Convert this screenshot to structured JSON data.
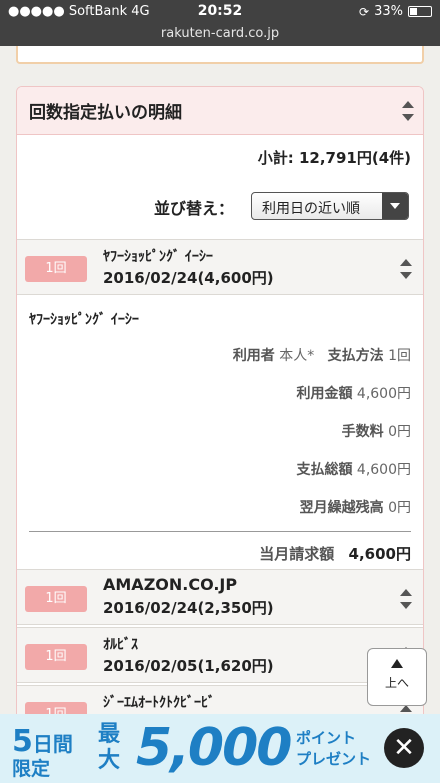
{
  "status_bar": {
    "carrier": "●●●●● SoftBank   4G",
    "time": "20:52",
    "battery": "33%",
    "battery_level": 0.33
  },
  "browser": {
    "url": "rakuten-card.co.jp"
  },
  "section": {
    "title": "回数指定払いの明細",
    "subtotal": "小計: 12,791円(4件)",
    "sort_label": "並び替え：",
    "sort_value": "利用日の近い順"
  },
  "items": [
    {
      "badge": "1回",
      "merchant": "ﾔﾌｰｼｮｯﾋﾟﾝｸﾞ ｲｰｼｰ",
      "date_amount": "2016/02/24(4,600円)"
    },
    {
      "badge": "1回",
      "merchant": "AMAZON.CO.JP",
      "date_amount": "2016/02/24(2,350円)"
    },
    {
      "badge": "1回",
      "merchant": "ｵﾙﾋﾞｽ",
      "date_amount": "2016/02/05(1,620円)"
    },
    {
      "badge": "1回",
      "merchant": "ｼﾞｰｴﾑｵｰﾄｸﾄｸﾋﾞｰﾋﾞ",
      "date_amount": ""
    }
  ],
  "detail": {
    "merchant": "ﾔﾌｰｼｮｯﾋﾟﾝｸﾞ ｲｰｼｰ",
    "user_label": "利用者",
    "user_value": "本人*",
    "method_label": "支払方法",
    "method_value": "1回",
    "amount_label": "利用金額",
    "amount_value": "4,600円",
    "fee_label": "手数料",
    "fee_value": "0円",
    "total_label": "支払総額",
    "total_value": "4,600円",
    "carry_label": "翌月繰越残高",
    "carry_value": "0円",
    "monthly_label": "当月請求額",
    "monthly_value": "4,600円"
  },
  "to_top": {
    "label": "上へ"
  },
  "banner": {
    "days_num": "5",
    "days_unit": "日間",
    "limited": "限定",
    "max": "最大",
    "amount": "5,000",
    "point_line1": "ポイント",
    "point_line2": "プレゼント",
    "close": "✕"
  }
}
